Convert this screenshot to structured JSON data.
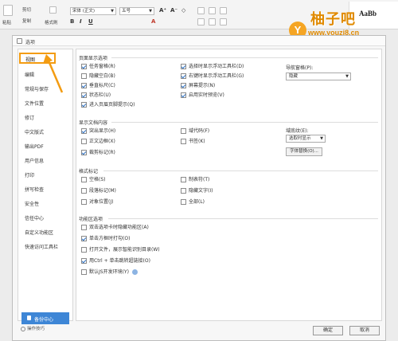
{
  "ribbon": {
    "paste": "粘贴",
    "cut": "剪切",
    "copy": "复制",
    "format_painter": "格式刷",
    "font_name": "宋体 (正文)",
    "font_size": "五号",
    "style_preview": "AaBb"
  },
  "watermark": {
    "circle": "Y",
    "title": "柚子吧",
    "url": "www.youzi8.cn"
  },
  "dialog": {
    "title": "选项",
    "sidebar": {
      "active": "视图",
      "items": [
        "编辑",
        "常规与保存",
        "文件位置",
        "修订",
        "中文版式",
        "输出PDF",
        "用户信息",
        "打印",
        "拼写检查",
        "安全性",
        "信任中心",
        "自定义功能区",
        "快速访问工具栏"
      ],
      "backup": "备份中心",
      "skills": "操作技巧"
    },
    "page_display": {
      "title": "页面显示选项",
      "col1": [
        {
          "label": "任务窗格(R)",
          "checked": true
        },
        {
          "label": "隐藏空白(B)",
          "checked": false
        },
        {
          "label": "垂直标尺(C)",
          "checked": true
        },
        {
          "label": "状态栏(U)",
          "checked": true
        },
        {
          "label": "进入页眉页脚提示(Q)",
          "checked": true
        }
      ],
      "col2": [
        {
          "label": "选择时显示浮动工具栏(D)",
          "checked": true
        },
        {
          "label": "右键时显示浮动工具栏(G)",
          "checked": true
        },
        {
          "label": "屏幕提示(N)",
          "checked": true
        },
        {
          "label": "启用实时预览(V)",
          "checked": true
        }
      ],
      "nav_label": "导航窗格(P):",
      "nav_value": "隐藏"
    },
    "show_doc": {
      "title": "显示文档内容",
      "col1": [
        {
          "label": "突出显示(H)",
          "checked": true
        },
        {
          "label": "正文边框(X)",
          "checked": false
        },
        {
          "label": "裁剪标记(R)",
          "checked": true
        }
      ],
      "col2": [
        {
          "label": "域代码(F)",
          "checked": false
        },
        {
          "label": "书签(K)",
          "checked": false
        }
      ],
      "field_label": "域底纹(E):",
      "field_value": "选取时显示",
      "font_sub_button": "字体替换(O)..."
    },
    "format_marks": {
      "title": "格式标记",
      "col1": [
        {
          "label": "空格(S)",
          "checked": false
        },
        {
          "label": "段落标记(M)",
          "checked": false
        },
        {
          "label": "对象位置(J)",
          "checked": false
        }
      ],
      "col2": [
        {
          "label": "制表符(T)",
          "checked": false
        },
        {
          "label": "隐藏文字(I)",
          "checked": false
        },
        {
          "label": "全部(L)",
          "checked": false
        }
      ]
    },
    "ribbon_options": {
      "title": "功能区选项",
      "items": [
        {
          "label": "双击选项卡时隐藏功能区(A)",
          "checked": false
        },
        {
          "label": "单击方框时打勾(O)",
          "checked": true
        },
        {
          "label": "打开文件，展示智能识别目录(W)",
          "checked": false
        },
        {
          "label": "用Ctrl + 单击跳转超链接(O)",
          "checked": true
        },
        {
          "label": "默认JS开发环境(Y)",
          "checked": false
        }
      ]
    },
    "ok": "确定",
    "cancel": "取消"
  },
  "colors": {
    "highlight": "#f39c12",
    "backup_bg": "#3e86d6",
    "watermark": "#e08a00"
  }
}
